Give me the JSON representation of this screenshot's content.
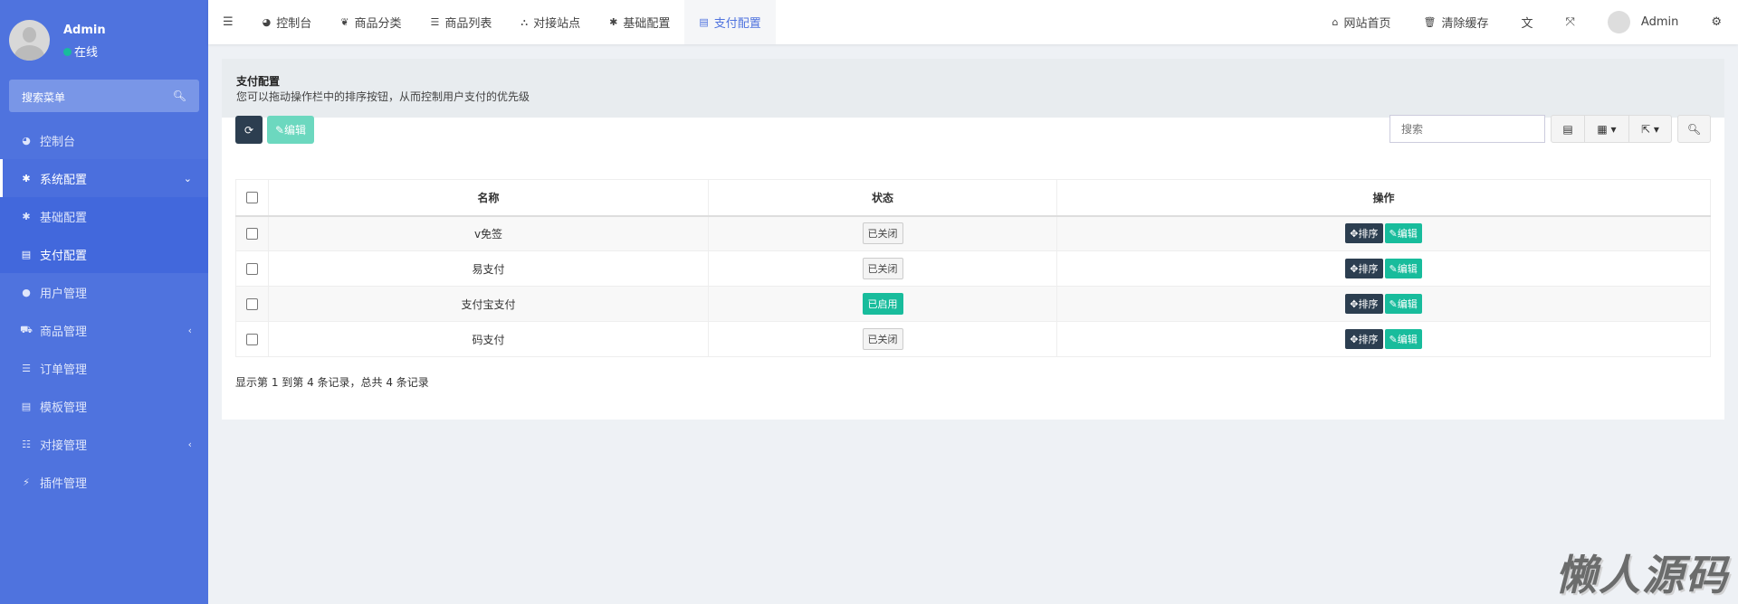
{
  "sidebar": {
    "user": {
      "name": "Admin",
      "status": "在线"
    },
    "search_placeholder": "搜索菜单",
    "items": [
      {
        "label": "控制台",
        "icon": "dashboard-icon"
      },
      {
        "label": "系统配置",
        "icon": "gear-icon"
      },
      {
        "label": "基础配置",
        "icon": "gear-icon"
      },
      {
        "label": "支付配置",
        "icon": "list-icon"
      },
      {
        "label": "用户管理",
        "icon": "user-icon"
      },
      {
        "label": "商品管理",
        "icon": "cart-icon"
      },
      {
        "label": "订单管理",
        "icon": "bars-icon"
      },
      {
        "label": "模板管理",
        "icon": "list-icon"
      },
      {
        "label": "对接管理",
        "icon": "sliders-icon"
      },
      {
        "label": "插件管理",
        "icon": "plug-icon"
      }
    ]
  },
  "topnav": {
    "tabs": [
      "控制台",
      "商品分类",
      "商品列表",
      "对接站点",
      "基础配置",
      "支付配置"
    ],
    "right": {
      "home": "网站首页",
      "clear_cache": "清除缓存",
      "user": "Admin"
    }
  },
  "panel": {
    "title": "支付配置",
    "description": "您可以拖动操作栏中的排序按钮，从而控制用户支付的优先级",
    "toolbar": {
      "edit": "编辑",
      "search_placeholder": "搜索"
    },
    "table": {
      "headers": [
        "名称",
        "状态",
        "操作"
      ],
      "rows": [
        {
          "name": "v免签",
          "status": "已关闭",
          "enabled": false
        },
        {
          "name": "易支付",
          "status": "已关闭",
          "enabled": false
        },
        {
          "name": "支付宝支付",
          "status": "已启用",
          "enabled": true
        },
        {
          "name": "码支付",
          "status": "已关闭",
          "enabled": false
        }
      ],
      "sort_label": "排序",
      "edit_label": "编辑"
    },
    "footer": "显示第 1 到第 4 条记录，总共 4 条记录"
  },
  "watermark": "懒人源码",
  "colors": {
    "sidebar": "#4f73de",
    "primary": "#2c3e50",
    "success": "#18bc9c"
  }
}
